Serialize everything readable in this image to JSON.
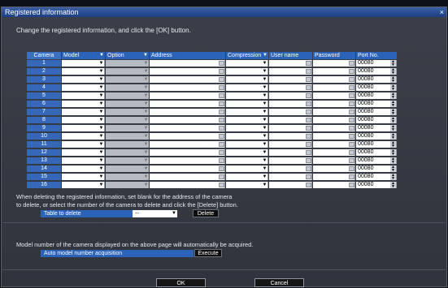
{
  "window": {
    "title": "Registered information",
    "close_label": "×"
  },
  "instruction": "Change the registered information, and click the [OK] button.",
  "table": {
    "headers": {
      "camera": "Camera",
      "model": "Model",
      "option": "Option",
      "address": "Address",
      "compression": "Compression",
      "user_name": "User name",
      "password": "Password",
      "port_no": "Port No."
    },
    "rows": [
      {
        "camera": "1",
        "port": "00080"
      },
      {
        "camera": "2",
        "port": "00080"
      },
      {
        "camera": "3",
        "port": "00080"
      },
      {
        "camera": "4",
        "port": "00080"
      },
      {
        "camera": "5",
        "port": "00080"
      },
      {
        "camera": "6",
        "port": "00080"
      },
      {
        "camera": "7",
        "port": "00080"
      },
      {
        "camera": "8",
        "port": "00080"
      },
      {
        "camera": "9",
        "port": "00080"
      },
      {
        "camera": "10",
        "port": "00080"
      },
      {
        "camera": "11",
        "port": "00080"
      },
      {
        "camera": "12",
        "port": "00080"
      },
      {
        "camera": "13",
        "port": "00080"
      },
      {
        "camera": "14",
        "port": "00080"
      },
      {
        "camera": "15",
        "port": "00080"
      },
      {
        "camera": "16",
        "port": "00080"
      }
    ]
  },
  "delete_section": {
    "note_line1": "When deleting the registered information, set blank for the address of the camera",
    "note_line2": "to delete, or select the number of the camera to delete and click the [Delete] button.",
    "label": "Table to delete",
    "select_value": "--",
    "button": "Delete"
  },
  "auto_section": {
    "note": "Model number of the camera displayed on the above page will automatically be acquired.",
    "label": "Auto model number acquisition",
    "button": "Execute"
  },
  "footer": {
    "ok": "OK",
    "cancel": "Cancel"
  }
}
